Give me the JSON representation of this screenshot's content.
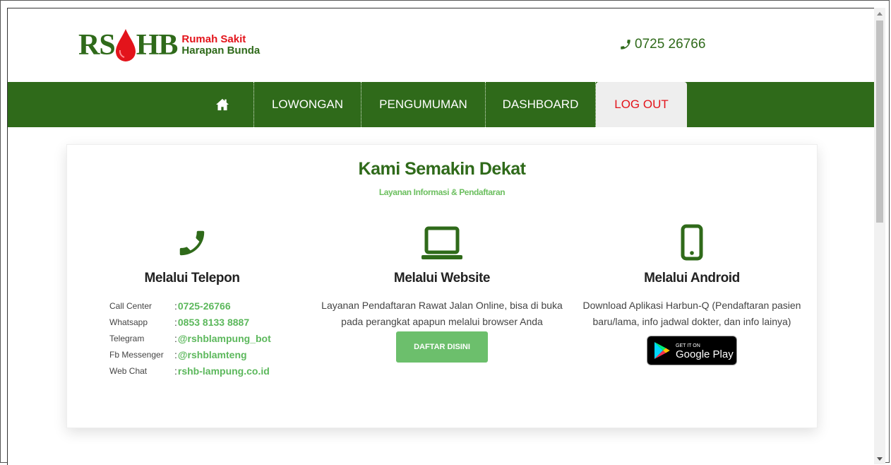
{
  "header": {
    "logo_letters_left": "RS",
    "logo_letters_right": "HB",
    "logo_line1": "Rumah Sakit",
    "logo_line2": "Harapan Bunda",
    "phone": "0725 26766"
  },
  "nav": {
    "items": [
      {
        "label": "",
        "icon": "home-icon"
      },
      {
        "label": "LOWONGAN"
      },
      {
        "label": "PENGUMUMAN"
      },
      {
        "label": "DASHBOARD"
      },
      {
        "label": "LOG OUT"
      }
    ]
  },
  "main": {
    "title": "Kami Semakin Dekat",
    "subtitle": "Layanan Informasi & Pendaftaran",
    "telepon": {
      "icon": "phone-icon",
      "title": "Melalui Telepon",
      "contacts": [
        {
          "label": "Call Center",
          "value": "0725-26766"
        },
        {
          "label": "Whatsapp",
          "value": "0853 8133 8887"
        },
        {
          "label": "Telegram",
          "value": "@rshblampung_bot"
        },
        {
          "label": "Fb Messenger",
          "value": "@rshblamteng"
        },
        {
          "label": "Web Chat",
          "value": "rshb-lampung.co.id"
        }
      ]
    },
    "website": {
      "icon": "laptop-icon",
      "title": "Melalui Website",
      "text": "Layanan Pendaftaran Rawat Jalan Online, bisa di buka pada perangkat apapun melalui browser Anda",
      "button": "DAFTAR DISINI"
    },
    "android": {
      "icon": "mobile-icon",
      "title": "Melalui Android",
      "text": "Download Aplikasi Harbun-Q (Pendaftaran pasien baru/lama, info jadwal dokter, dan info lainya)",
      "badge_small": "GET IT ON",
      "badge_big": "Google Play"
    }
  },
  "colors": {
    "brand_green": "#2f6a1a",
    "accent_green": "#5cb85c",
    "brand_red": "#e3141b",
    "button_green": "#6cbf6c"
  }
}
